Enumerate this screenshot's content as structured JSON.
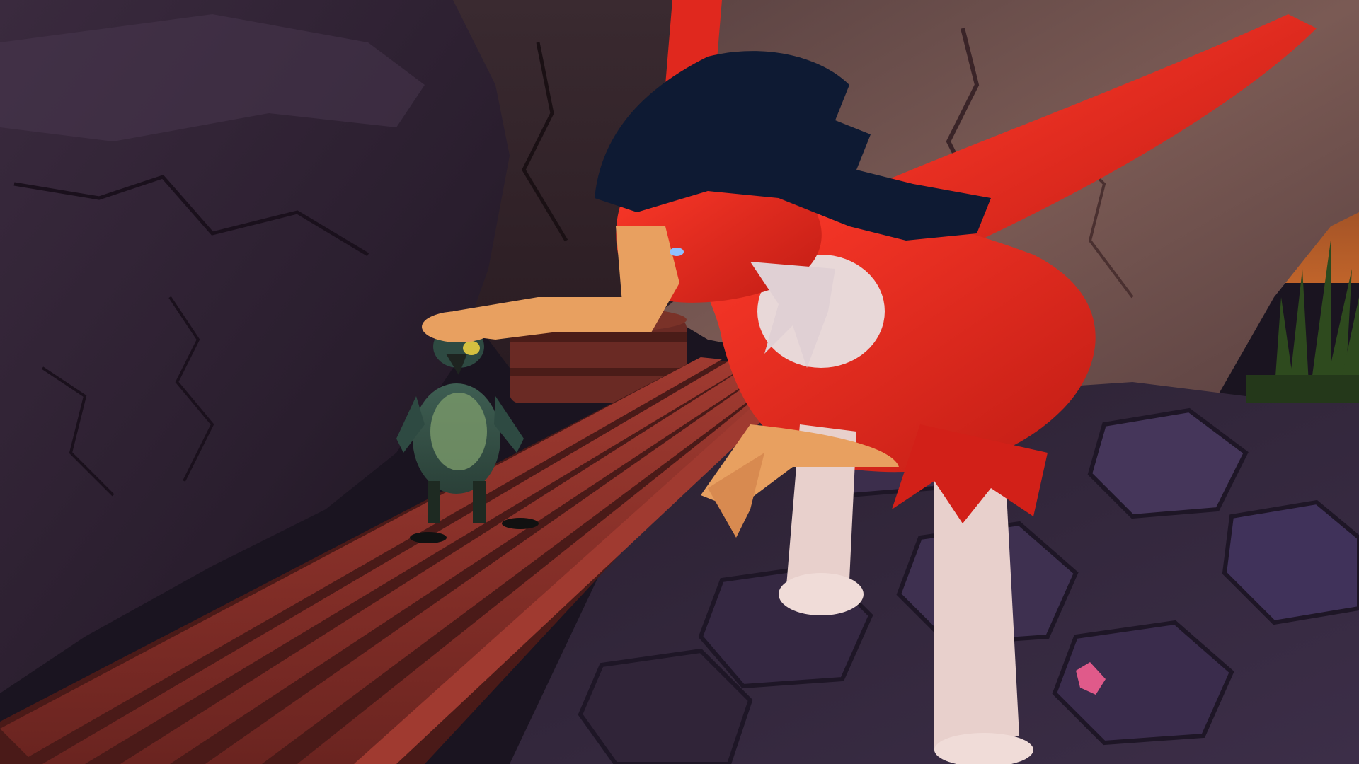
{
  "scene": {
    "description_kind": "3d-game-viewport",
    "hud_text": [],
    "colors": {
      "rock_dark": "#2a1e2c",
      "rock_mid": "#3a2a3c",
      "rock_warm": "#7a5a52",
      "sky_glow": "#b5602e",
      "bench_wood": "#7a2a24",
      "bench_wood_light": "#9a3a30",
      "floor_stone": "#3a2d44",
      "floor_stone_light": "#4a3a56",
      "red_creature_body": "#e0281e",
      "red_creature_crest": "#0e1a33",
      "red_creature_belly": "#e8d8d8",
      "red_creature_limbs": "#e8a060",
      "red_creature_legs": "#e8d0cc",
      "small_creature_body": "#4a6a5a",
      "small_creature_belly": "#7a9a6a",
      "grass": "#2e4a1e",
      "petal": "#e05a8a"
    }
  }
}
